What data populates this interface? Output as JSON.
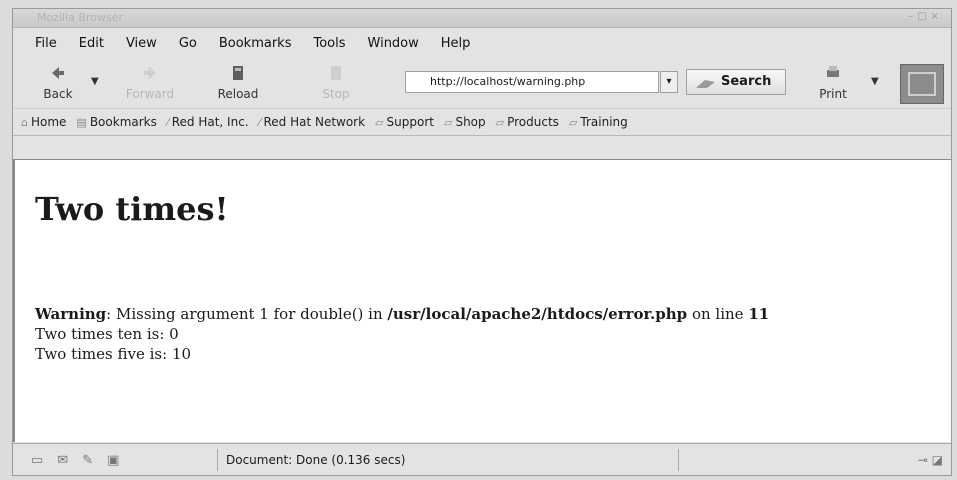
{
  "window": {
    "title": "Mozilla Browser"
  },
  "menu": {
    "items": [
      "File",
      "Edit",
      "View",
      "Go",
      "Bookmarks",
      "Tools",
      "Window",
      "Help"
    ]
  },
  "toolbar": {
    "back": "Back",
    "forward": "Forward",
    "reload": "Reload",
    "stop": "Stop",
    "url": "http://localhost/warning.php",
    "search": "Search",
    "print": "Print"
  },
  "bookmarks": [
    "Home",
    "Bookmarks",
    "Red Hat, Inc.",
    "Red Hat Network",
    "Support",
    "Shop",
    "Products",
    "Training"
  ],
  "page": {
    "heading": "Two times!",
    "warning_label": "Warning",
    "warning_text": ": Missing argument 1 for double() in ",
    "warning_path": "/usr/local/apache2/htdocs/error.php",
    "warning_line_text": " on line ",
    "warning_line_no": "11",
    "line2": "Two times ten is: 0",
    "line3": "Two times five is: 10"
  },
  "status": {
    "text": "Document: Done (0.136 secs)"
  }
}
